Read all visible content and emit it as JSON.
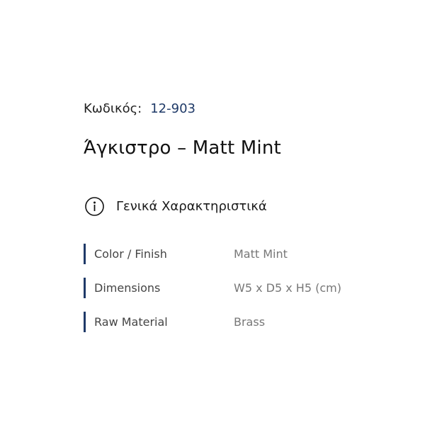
{
  "product": {
    "code_label": "Κωδικός:",
    "code_value": "12-903",
    "title": "Άγκιστρο – Matt Mint"
  },
  "section": {
    "icon": "info-icon",
    "title": "Γενικά Χαρακτηριστικά"
  },
  "specs": [
    {
      "label": "Color / Finish",
      "value": "Matt Mint"
    },
    {
      "label": "Dimensions",
      "value": "W5 x D5 x H5 (cm)"
    },
    {
      "label": "Raw Material",
      "value": "Brass"
    }
  ],
  "colors": {
    "accent": "#1f3a68",
    "label_text": "#444444",
    "value_text": "#777777"
  }
}
